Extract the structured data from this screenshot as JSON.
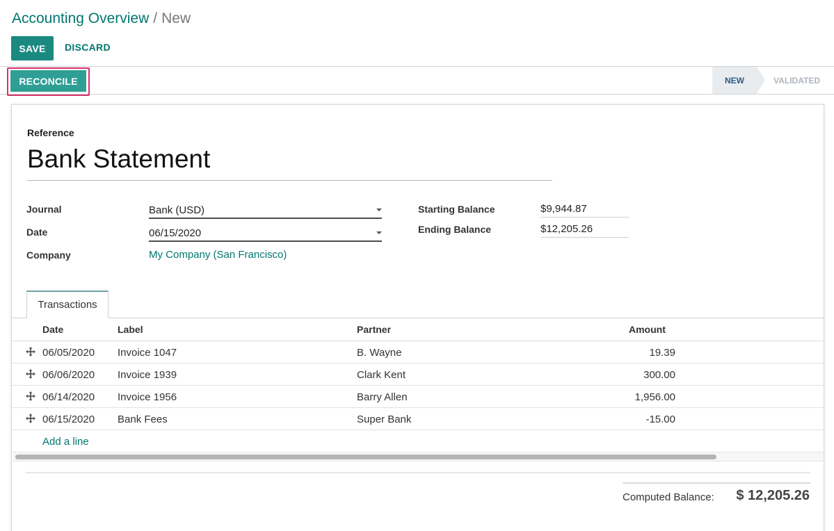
{
  "breadcrumb": {
    "parent": "Accounting Overview",
    "separator": "/",
    "current": "New"
  },
  "toolbar": {
    "save_label": "SAVE",
    "discard_label": "DISCARD"
  },
  "statusbar": {
    "reconcile_label": "RECONCILE",
    "stages": [
      "NEW",
      "VALIDATED"
    ],
    "active_stage": "NEW",
    "highlight_color": "#d6336c"
  },
  "form": {
    "reference_label": "Reference",
    "reference_value": "Bank Statement",
    "journal_label": "Journal",
    "journal_value": "Bank (USD)",
    "date_label": "Date",
    "date_value": "06/15/2020",
    "company_label": "Company",
    "company_value": "My Company (San Francisco)",
    "starting_balance_label": "Starting Balance",
    "starting_balance_value": "$9,944.87",
    "ending_balance_label": "Ending Balance",
    "ending_balance_value": "$12,205.26"
  },
  "tabs": [
    {
      "label": "Transactions",
      "active": true
    }
  ],
  "table": {
    "headers": {
      "date": "Date",
      "label": "Label",
      "partner": "Partner",
      "amount": "Amount"
    },
    "rows": [
      {
        "date": "06/05/2020",
        "label": "Invoice 1047",
        "partner": "B. Wayne",
        "amount": "19.39"
      },
      {
        "date": "06/06/2020",
        "label": "Invoice 1939",
        "partner": "Clark Kent",
        "amount": "300.00"
      },
      {
        "date": "06/14/2020",
        "label": "Invoice 1956",
        "partner": "Barry Allen",
        "amount": "1,956.00"
      },
      {
        "date": "06/15/2020",
        "label": "Bank Fees",
        "partner": "Super Bank",
        "amount": "-15.00"
      }
    ],
    "add_line_label": "Add a line"
  },
  "totals": {
    "computed_label": "Computed Balance:",
    "computed_value": "$ 12,205.26"
  },
  "colors": {
    "primary": "#1a8a80",
    "link": "#00766f"
  },
  "icons": {
    "row_handle": "move-handle-icon",
    "select_caret": "caret-down-icon"
  }
}
